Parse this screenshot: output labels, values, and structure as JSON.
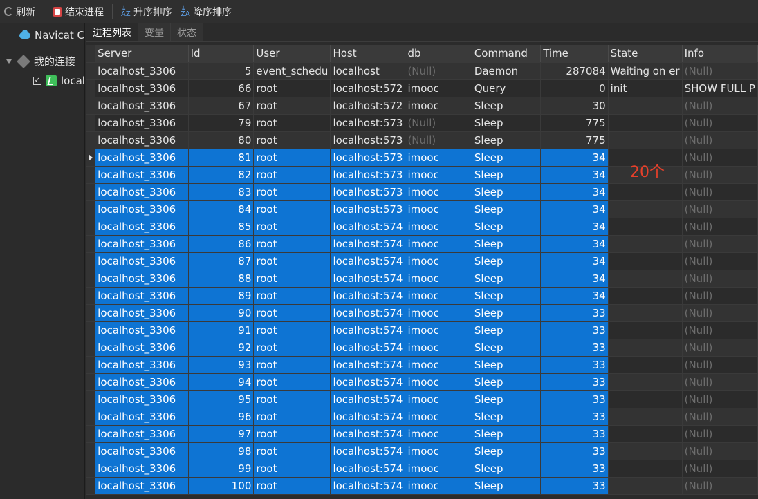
{
  "toolbar": {
    "refresh": "刷新",
    "kill_process": "结束进程",
    "sort_asc": "升序排序",
    "sort_desc": "降序排序"
  },
  "sidebar": {
    "cloud": "Navicat Cl",
    "my_connections": "我的连接",
    "connection": "local"
  },
  "tabs": [
    "进程列表",
    "变量",
    "状态"
  ],
  "columns": [
    "Server",
    "Id",
    "User",
    "Host",
    "db",
    "Command",
    "Time",
    "State",
    "Info"
  ],
  "rows": [
    [
      "localhost_3306",
      "5",
      "event_schedu",
      "localhost",
      "(Null)",
      "Daemon",
      "287084",
      "Waiting on er",
      "(Null)"
    ],
    [
      "localhost_3306",
      "66",
      "root",
      "localhost:572",
      "imooc",
      "Query",
      "0",
      "init",
      "SHOW FULL P"
    ],
    [
      "localhost_3306",
      "67",
      "root",
      "localhost:572",
      "imooc",
      "Sleep",
      "30",
      "",
      "(Null)"
    ],
    [
      "localhost_3306",
      "79",
      "root",
      "localhost:573",
      "(Null)",
      "Sleep",
      "775",
      "",
      "(Null)"
    ],
    [
      "localhost_3306",
      "80",
      "root",
      "localhost:573",
      "(Null)",
      "Sleep",
      "775",
      "",
      "(Null)"
    ],
    [
      "localhost_3306",
      "81",
      "root",
      "localhost:573",
      "imooc",
      "Sleep",
      "34",
      "",
      "(Null)"
    ],
    [
      "localhost_3306",
      "82",
      "root",
      "localhost:573",
      "imooc",
      "Sleep",
      "34",
      "",
      "(Null)"
    ],
    [
      "localhost_3306",
      "83",
      "root",
      "localhost:573",
      "imooc",
      "Sleep",
      "34",
      "",
      "(Null)"
    ],
    [
      "localhost_3306",
      "84",
      "root",
      "localhost:573",
      "imooc",
      "Sleep",
      "34",
      "",
      "(Null)"
    ],
    [
      "localhost_3306",
      "85",
      "root",
      "localhost:574",
      "imooc",
      "Sleep",
      "34",
      "",
      "(Null)"
    ],
    [
      "localhost_3306",
      "86",
      "root",
      "localhost:574",
      "imooc",
      "Sleep",
      "34",
      "",
      "(Null)"
    ],
    [
      "localhost_3306",
      "87",
      "root",
      "localhost:574",
      "imooc",
      "Sleep",
      "34",
      "",
      "(Null)"
    ],
    [
      "localhost_3306",
      "88",
      "root",
      "localhost:574",
      "imooc",
      "Sleep",
      "34",
      "",
      "(Null)"
    ],
    [
      "localhost_3306",
      "89",
      "root",
      "localhost:574",
      "imooc",
      "Sleep",
      "34",
      "",
      "(Null)"
    ],
    [
      "localhost_3306",
      "90",
      "root",
      "localhost:574",
      "imooc",
      "Sleep",
      "33",
      "",
      "(Null)"
    ],
    [
      "localhost_3306",
      "91",
      "root",
      "localhost:574",
      "imooc",
      "Sleep",
      "33",
      "",
      "(Null)"
    ],
    [
      "localhost_3306",
      "92",
      "root",
      "localhost:574",
      "imooc",
      "Sleep",
      "33",
      "",
      "(Null)"
    ],
    [
      "localhost_3306",
      "93",
      "root",
      "localhost:574",
      "imooc",
      "Sleep",
      "33",
      "",
      "(Null)"
    ],
    [
      "localhost_3306",
      "94",
      "root",
      "localhost:574",
      "imooc",
      "Sleep",
      "33",
      "",
      "(Null)"
    ],
    [
      "localhost_3306",
      "95",
      "root",
      "localhost:574",
      "imooc",
      "Sleep",
      "33",
      "",
      "(Null)"
    ],
    [
      "localhost_3306",
      "96",
      "root",
      "localhost:574",
      "imooc",
      "Sleep",
      "33",
      "",
      "(Null)"
    ],
    [
      "localhost_3306",
      "97",
      "root",
      "localhost:574",
      "imooc",
      "Sleep",
      "33",
      "",
      "(Null)"
    ],
    [
      "localhost_3306",
      "98",
      "root",
      "localhost:574",
      "imooc",
      "Sleep",
      "33",
      "",
      "(Null)"
    ],
    [
      "localhost_3306",
      "99",
      "root",
      "localhost:574",
      "imooc",
      "Sleep",
      "33",
      "",
      "(Null)"
    ],
    [
      "localhost_3306",
      "100",
      "root",
      "localhost:574",
      "imooc",
      "Sleep",
      "33",
      "",
      "(Null)"
    ]
  ],
  "selected_rows": [
    5,
    24
  ],
  "current_row": 5,
  "annotation": "20个",
  "colors": {
    "selection": "#0e74d3",
    "annotation": "#e8402a",
    "null_text": "#6c6c6c"
  }
}
